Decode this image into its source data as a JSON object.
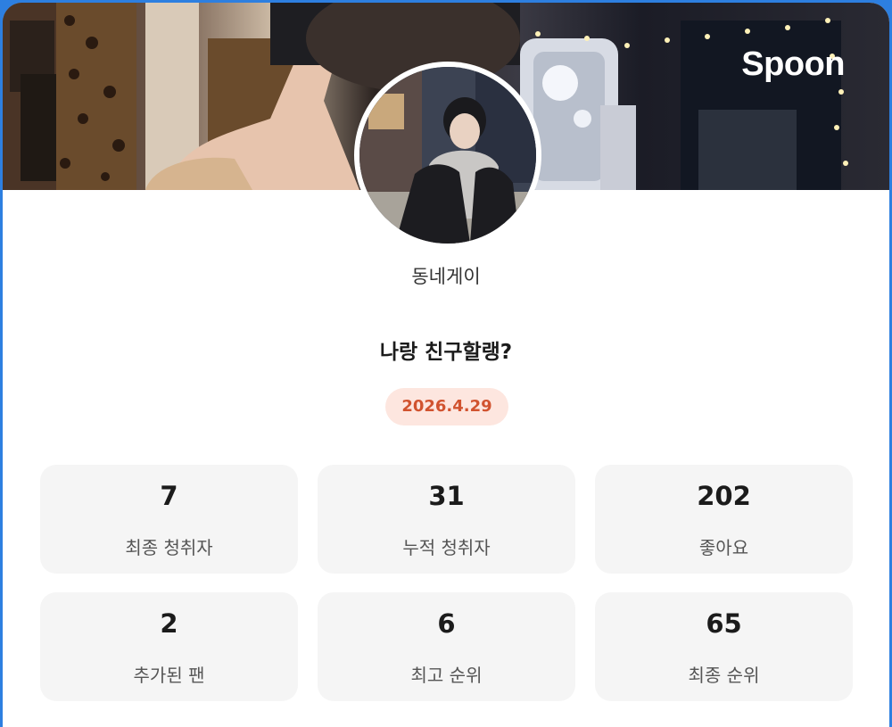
{
  "brand": "Spoon",
  "profile": {
    "nickname": "동네게이"
  },
  "broadcast": {
    "title": "나랑 친구할랭?",
    "date": "2026.4.29"
  },
  "stats": [
    {
      "value": "7",
      "label": "최종 청취자"
    },
    {
      "value": "31",
      "label": "누적 청취자"
    },
    {
      "value": "202",
      "label": "좋아요"
    },
    {
      "value": "2",
      "label": "추가된 팬"
    },
    {
      "value": "6",
      "label": "최고 순위"
    },
    {
      "value": "65",
      "label": "최종 순위"
    }
  ],
  "colors": {
    "frame": "#2d7fe0",
    "date_text": "#d1532f",
    "date_bg": "#fde6df",
    "stat_bg": "#f5f5f5"
  }
}
